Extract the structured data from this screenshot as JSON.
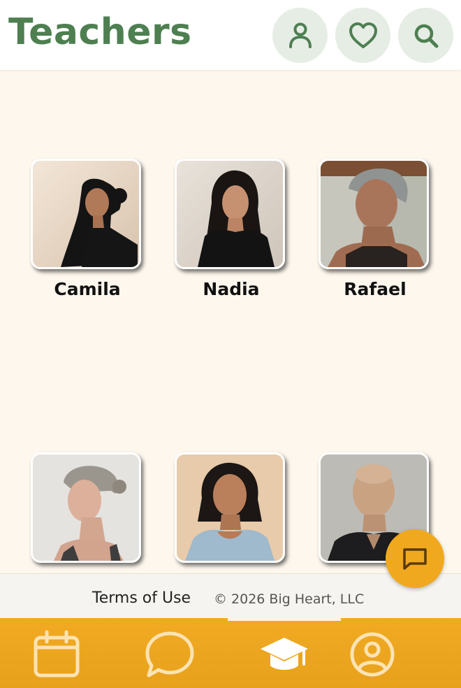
{
  "header": {
    "title": "Teachers",
    "buttons": [
      {
        "icon": "person-icon"
      },
      {
        "icon": "heart-icon"
      },
      {
        "icon": "search-icon"
      }
    ]
  },
  "teachers": [
    {
      "name": "Camila"
    },
    {
      "name": "Nadia"
    },
    {
      "name": "Rafael"
    },
    {
      "name": ""
    },
    {
      "name": ""
    },
    {
      "name": ""
    }
  ],
  "footer": {
    "terms_label": "Terms of Use",
    "copyright": "© 2026 Big Heart, LLC"
  },
  "fab": {
    "icon": "chat-icon"
  },
  "bottom_nav": {
    "items": [
      {
        "icon": "calendar-icon",
        "active": false
      },
      {
        "icon": "chat-bubble-icon",
        "active": false
      },
      {
        "icon": "graduation-cap-icon",
        "active": true
      },
      {
        "icon": "profile-icon",
        "active": false
      }
    ]
  },
  "colors": {
    "brand_green": "#4e7f51",
    "accent_orange": "#f0a91f",
    "background": "#fdf7ee"
  }
}
